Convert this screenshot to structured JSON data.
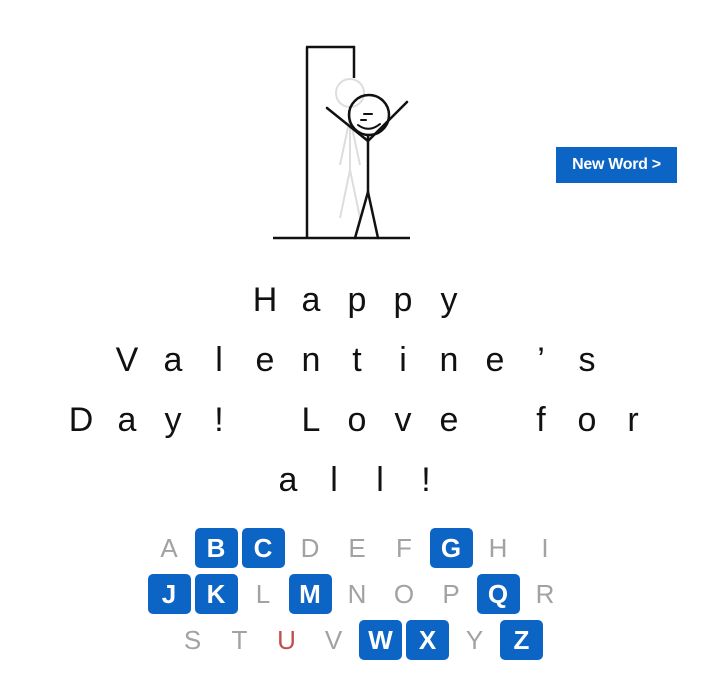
{
  "game": {
    "new_word_label": "New Word >"
  },
  "phrase": {
    "lines": [
      [
        "H",
        "a",
        "p",
        "p",
        "y"
      ],
      [
        "V",
        "a",
        "l",
        "e",
        "n",
        "t",
        "i",
        "n",
        "e",
        "’",
        "s"
      ],
      [
        "D",
        "a",
        "y",
        "!",
        " ",
        "L",
        "o",
        "v",
        "e",
        " ",
        "f",
        "o",
        "r"
      ],
      [
        "a",
        "l",
        "l",
        "!"
      ]
    ]
  },
  "keyboard": {
    "rows": [
      [
        {
          "letter": "A",
          "state": "used"
        },
        {
          "letter": "B",
          "state": "available"
        },
        {
          "letter": "C",
          "state": "available"
        },
        {
          "letter": "D",
          "state": "used"
        },
        {
          "letter": "E",
          "state": "used"
        },
        {
          "letter": "F",
          "state": "used"
        },
        {
          "letter": "G",
          "state": "available"
        },
        {
          "letter": "H",
          "state": "used"
        },
        {
          "letter": "I",
          "state": "used"
        }
      ],
      [
        {
          "letter": "J",
          "state": "available"
        },
        {
          "letter": "K",
          "state": "available"
        },
        {
          "letter": "L",
          "state": "used"
        },
        {
          "letter": "M",
          "state": "available"
        },
        {
          "letter": "N",
          "state": "used"
        },
        {
          "letter": "O",
          "state": "used"
        },
        {
          "letter": "P",
          "state": "used"
        },
        {
          "letter": "Q",
          "state": "available"
        },
        {
          "letter": "R",
          "state": "used"
        }
      ],
      [
        {
          "letter": "S",
          "state": "used"
        },
        {
          "letter": "T",
          "state": "used"
        },
        {
          "letter": "U",
          "state": "wrong"
        },
        {
          "letter": "V",
          "state": "used"
        },
        {
          "letter": "W",
          "state": "available"
        },
        {
          "letter": "X",
          "state": "available"
        },
        {
          "letter": "Y",
          "state": "used"
        },
        {
          "letter": "Z",
          "state": "available"
        }
      ]
    ]
  },
  "colors": {
    "accent": "#0c65c4",
    "used": "#a2a2a2",
    "wrong": "#c0504d",
    "ink": "#111111"
  }
}
